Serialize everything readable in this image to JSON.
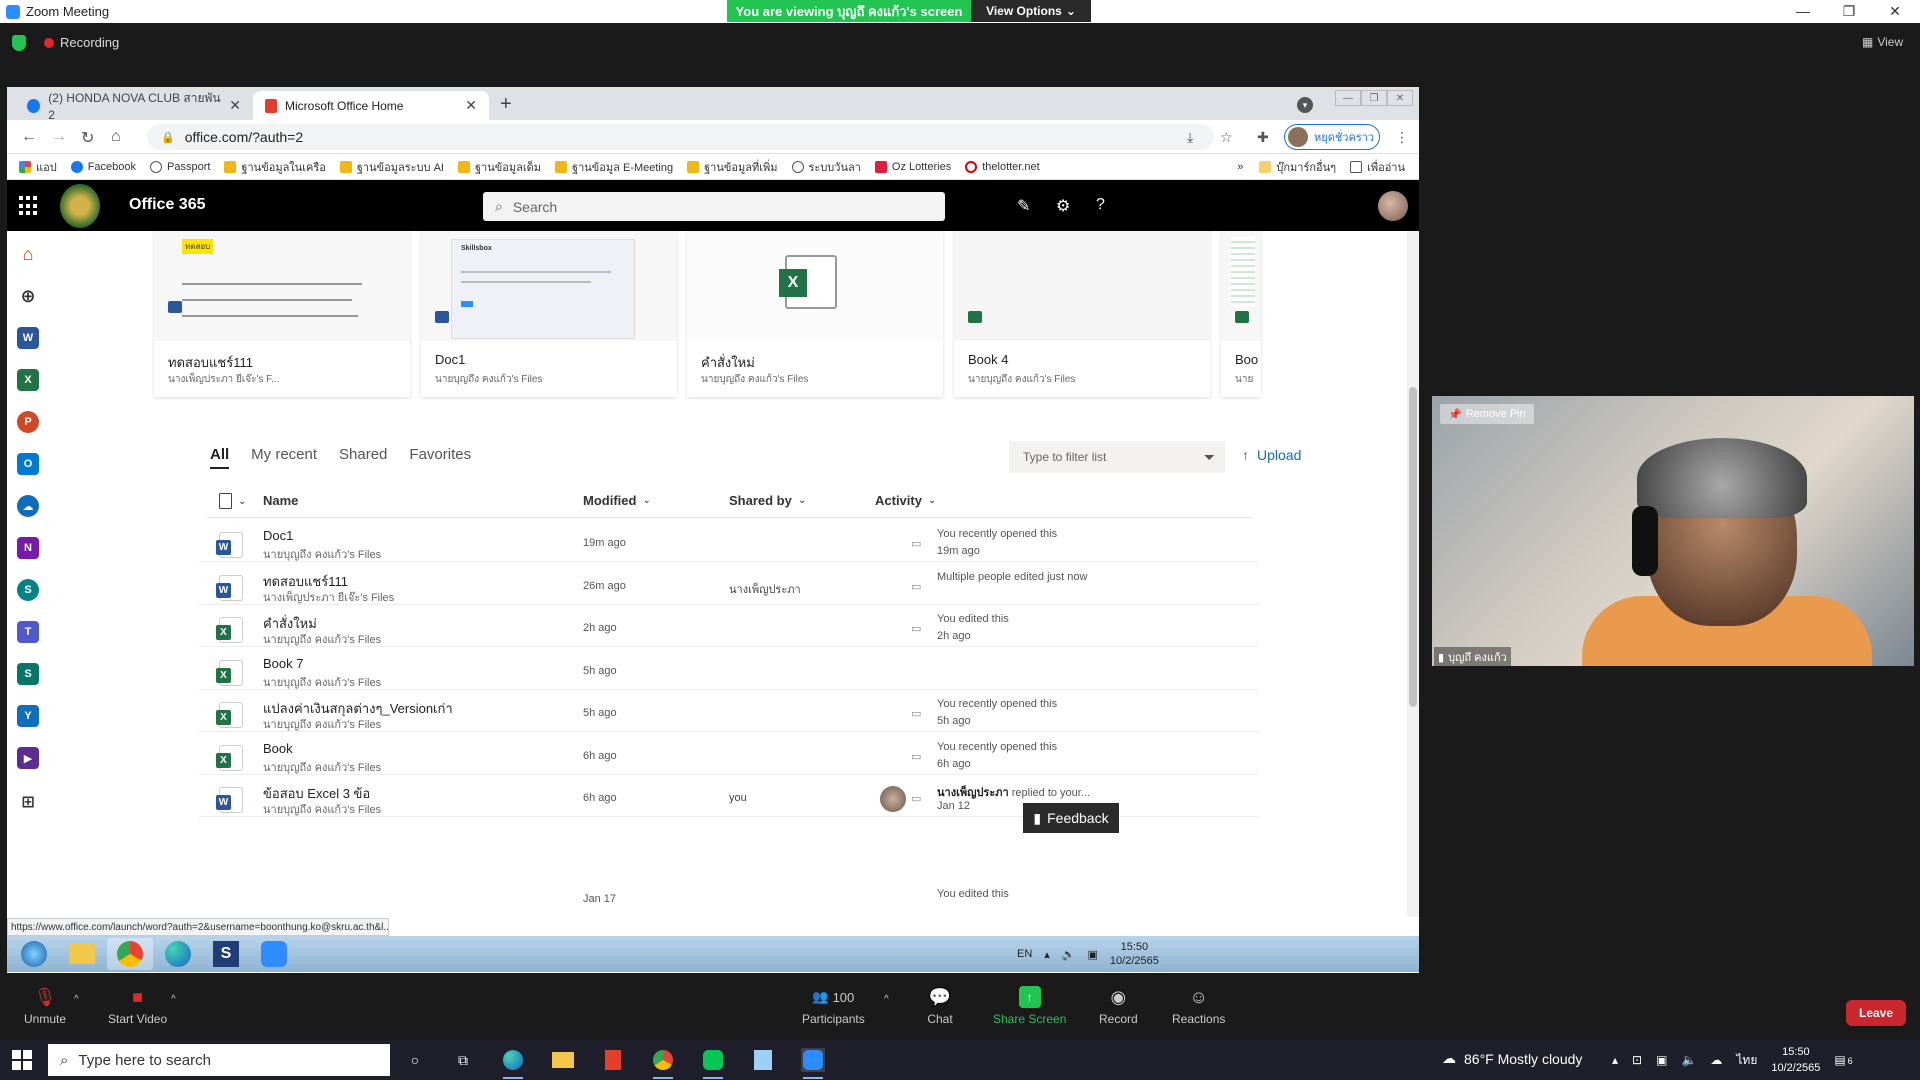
{
  "zoom": {
    "window_title": "Zoom Meeting",
    "banner_text": "You are viewing บุญถึ คงแก้ว's screen",
    "view_options_label": "View Options",
    "recording_label": "Recording",
    "view_label": "View",
    "controls": {
      "unmute": "Unmute",
      "start_video": "Start Video",
      "participants_count": "100",
      "participants": "Participants",
      "chat": "Chat",
      "share_screen": "Share Screen",
      "record": "Record",
      "reactions": "Reactions",
      "leave": "Leave"
    },
    "video": {
      "remove_pin": "Remove Pin",
      "participant_name": "บุญถึ คงแก้ว"
    },
    "colors": {
      "banner_green": "#23c552",
      "leave_red": "#c9262e"
    }
  },
  "browser": {
    "tabs": [
      {
        "label": "(2) HONDA NOVA CLUB สายพัน 2",
        "icon": "facebook-icon"
      },
      {
        "label": "Microsoft Office Home",
        "icon": "office-icon"
      }
    ],
    "url": "office.com/?auth=2",
    "profile_label": "หยุดชั่วคราว",
    "bookmarks": [
      "แอป",
      "Facebook",
      "Passport",
      "ฐานข้อมูลในเครือ",
      "ฐานข้อมูลระบบ AI",
      "ฐานข้อมูลเด็ม",
      "ฐานข้อมูล E-Meeting",
      "ฐานข้อมูลที่เพิ่ม",
      "ระบบวันลา",
      "Oz Lotteries",
      "thelotter.net"
    ],
    "bookmarks_right": [
      "บุ๊กมาร์กอื่นๆ",
      "เพื่ออ่าน"
    ],
    "status_url": "https://www.office.com/launch/word?auth=2&username=boonthung.ko@skru.ac.th&l..."
  },
  "office": {
    "title": "Office 365",
    "search_placeholder": "Search",
    "recent_cards": [
      {
        "name": "ทดสอบแชร์111",
        "owner": "นางเพ็ญประภา ยีเจ๊ะ's F...",
        "thumb_text": "ทดสอบ"
      },
      {
        "name": "Doc1",
        "owner": "นายบุญถึง คงแก้ว's Files",
        "thumb_text": "Skillsbox"
      },
      {
        "name": "คำสั่งใหม่",
        "owner": "นายบุญถึง คงแก้ว's Files"
      },
      {
        "name": "Book 4",
        "owner": "นายบุญถึง คงแก้ว's Files"
      },
      {
        "name": "Boo",
        "owner": "นาย"
      }
    ],
    "filter_tabs": [
      "All",
      "My recent",
      "Shared",
      "Favorites"
    ],
    "filter_placeholder": "Type to filter list",
    "upload_label": "Upload",
    "columns": {
      "name": "Name",
      "modified": "Modified",
      "shared_by": "Shared by",
      "activity": "Activity"
    },
    "files": [
      {
        "type": "word",
        "name": "Doc1",
        "owner": "นายบุญถึง คงแก้ว's Files",
        "modified": "19m ago",
        "shared_by": "",
        "activity_line1": "You recently opened this",
        "activity_line2": "19m ago",
        "activity_user": ""
      },
      {
        "type": "word",
        "name": "ทดสอบแชร์111",
        "owner": "นางเพ็ญประภา ยีเจ๊ะ's Files",
        "modified": "26m ago",
        "shared_by": "นางเพ็ญประภา",
        "activity_line1": "Multiple people edited just now",
        "activity_line2": "",
        "activity_user": ""
      },
      {
        "type": "excel",
        "name": "คำสั่งใหม่",
        "owner": "นายบุญถึง คงแก้ว's Files",
        "modified": "2h ago",
        "shared_by": "",
        "activity_line1": "You edited this",
        "activity_line2": "2h ago",
        "activity_user": ""
      },
      {
        "type": "excel",
        "name": "Book 7",
        "owner": "นายบุญถึง คงแก้ว's Files",
        "modified": "5h ago",
        "shared_by": "",
        "activity_line1": "",
        "activity_line2": "",
        "activity_user": ""
      },
      {
        "type": "excel",
        "name": "แปลงค่าเงินสกุลต่างๆ_Versionเก่า",
        "owner": "นายบุญถึง คงแก้ว's Files",
        "modified": "5h ago",
        "shared_by": "",
        "activity_line1": "You recently opened this",
        "activity_line2": "5h ago",
        "activity_user": ""
      },
      {
        "type": "excel",
        "name": "Book",
        "owner": "นายบุญถึง คงแก้ว's Files",
        "modified": "6h ago",
        "shared_by": "",
        "activity_line1": "You recently opened this",
        "activity_line2": "6h ago",
        "activity_user": ""
      },
      {
        "type": "word",
        "name": "ข้อสอบ Excel 3 ข้อ",
        "owner": "นายบุญถึง คงแก้ว's Files",
        "modified": "6h ago",
        "shared_by": "you",
        "activity_user": "นางเพ็ญประภา",
        "activity_line1": " replied to your...",
        "activity_line2": "Jan 12"
      }
    ],
    "partial_row": {
      "modified": "Jan 17",
      "activity": "You edited this"
    },
    "feedback_label": "Feedback",
    "colors": {
      "word": "#2b579a",
      "excel": "#217346",
      "accent": "#d83b01"
    }
  },
  "remote_taskbar": {
    "lang": "EN",
    "time": "15:50",
    "date": "10/2/2565"
  },
  "windows": {
    "search_placeholder": "Type here to search",
    "weather": "86°F  Mostly cloudy",
    "lang": "ไทย",
    "time": "15:50",
    "date": "10/2/2565",
    "notification_count": "6"
  }
}
